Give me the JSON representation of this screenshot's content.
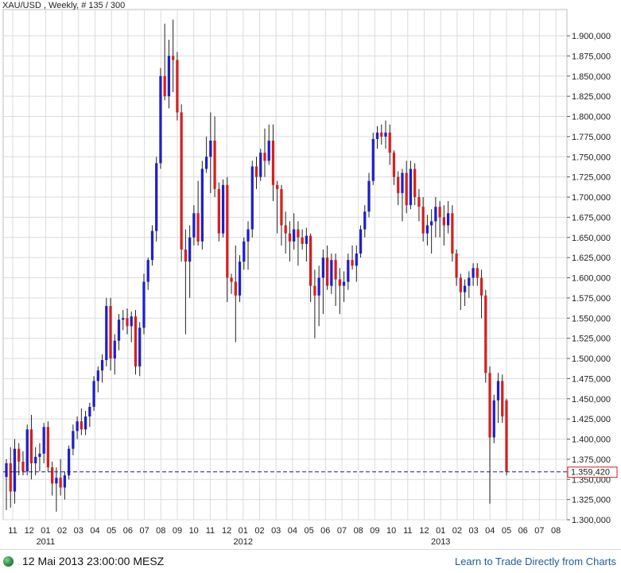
{
  "title": "XAU/USD , Weekly, # 135 / 300",
  "colors": {
    "up": "#1f1fc8",
    "down": "#d42020",
    "wick": "#222222",
    "grid": "#dcdcdc",
    "price_line": "#1a1a8c",
    "price_box": "#cc2222"
  },
  "footer": {
    "timestamp": "12 Mai 2013 23:00:00 MESZ",
    "link": "Learn to Trade Directly from Charts",
    "status_icon": "green-dot-icon"
  },
  "chart_data": {
    "type": "candlestick",
    "title": "XAU/USD , Weekly, # 135 / 300",
    "ylim": [
      1300,
      1925
    ],
    "yticks": [
      "1.300,000",
      "1.325,000",
      "1.350,000",
      "1.375,000",
      "1.400,000",
      "1.425,000",
      "1.450,000",
      "1.475,000",
      "1.500,000",
      "1.525,000",
      "1.550,000",
      "1.575,000",
      "1.600,000",
      "1.625,000",
      "1.650,000",
      "1.675,000",
      "1.700,000",
      "1.725,000",
      "1.750,000",
      "1.775,000",
      "1.800,000",
      "1.825,000",
      "1.850,000",
      "1.875,000",
      "1.900,000"
    ],
    "ytick_values": [
      1300,
      1325,
      1350,
      1375,
      1400,
      1425,
      1450,
      1475,
      1500,
      1525,
      1550,
      1575,
      1600,
      1625,
      1650,
      1675,
      1700,
      1725,
      1750,
      1775,
      1800,
      1825,
      1850,
      1875,
      1900
    ],
    "month_labels": [
      "11",
      "12",
      "01",
      "02",
      "03",
      "04",
      "05",
      "06",
      "07",
      "08",
      "09",
      "10",
      "11",
      "12",
      "01",
      "02",
      "03",
      "04",
      "05",
      "06",
      "07",
      "08",
      "09",
      "10",
      "11",
      "12",
      "01",
      "02",
      "03",
      "04",
      "05",
      "06",
      "07",
      "08"
    ],
    "year_labels": [
      {
        "label": "2011",
        "month_index": 2
      },
      {
        "label": "2012",
        "month_index": 14
      },
      {
        "label": "2013",
        "month_index": 26
      }
    ],
    "current_price": 1359.42,
    "current_price_label": "1.359,420",
    "candles": [
      [
        1353,
        1375,
        1312,
        1370
      ],
      [
        1370,
        1390,
        1315,
        1335
      ],
      [
        1335,
        1400,
        1320,
        1388
      ],
      [
        1388,
        1395,
        1355,
        1372
      ],
      [
        1372,
        1385,
        1355,
        1360
      ],
      [
        1360,
        1418,
        1355,
        1412
      ],
      [
        1412,
        1430,
        1350,
        1370
      ],
      [
        1370,
        1390,
        1355,
        1378
      ],
      [
        1378,
        1395,
        1360,
        1382
      ],
      [
        1382,
        1420,
        1370,
        1415
      ],
      [
        1415,
        1422,
        1360,
        1365
      ],
      [
        1365,
        1372,
        1330,
        1345
      ],
      [
        1345,
        1365,
        1310,
        1352
      ],
      [
        1352,
        1375,
        1330,
        1340
      ],
      [
        1340,
        1360,
        1325,
        1355
      ],
      [
        1355,
        1392,
        1350,
        1388
      ],
      [
        1388,
        1418,
        1380,
        1410
      ],
      [
        1410,
        1428,
        1400,
        1422
      ],
      [
        1422,
        1438,
        1405,
        1412
      ],
      [
        1412,
        1435,
        1405,
        1428
      ],
      [
        1428,
        1445,
        1415,
        1440
      ],
      [
        1440,
        1478,
        1435,
        1472
      ],
      [
        1472,
        1490,
        1458,
        1485
      ],
      [
        1485,
        1505,
        1470,
        1498
      ],
      [
        1498,
        1575,
        1490,
        1565
      ],
      [
        1565,
        1575,
        1485,
        1500
      ],
      [
        1500,
        1530,
        1480,
        1522
      ],
      [
        1522,
        1555,
        1510,
        1548
      ],
      [
        1548,
        1560,
        1535,
        1550
      ],
      [
        1550,
        1562,
        1530,
        1540
      ],
      [
        1540,
        1558,
        1520,
        1552
      ],
      [
        1552,
        1560,
        1480,
        1490
      ],
      [
        1490,
        1545,
        1478,
        1538
      ],
      [
        1538,
        1605,
        1530,
        1595
      ],
      [
        1595,
        1625,
        1585,
        1622
      ],
      [
        1622,
        1665,
        1615,
        1658
      ],
      [
        1658,
        1750,
        1645,
        1742
      ],
      [
        1742,
        1860,
        1735,
        1850
      ],
      [
        1850,
        1915,
        1820,
        1825
      ],
      [
        1825,
        1895,
        1810,
        1875
      ],
      [
        1875,
        1920,
        1830,
        1870
      ],
      [
        1870,
        1880,
        1795,
        1805
      ],
      [
        1805,
        1815,
        1620,
        1635
      ],
      [
        1635,
        1660,
        1530,
        1620
      ],
      [
        1620,
        1665,
        1575,
        1650
      ],
      [
        1650,
        1690,
        1640,
        1680
      ],
      [
        1680,
        1720,
        1640,
        1645
      ],
      [
        1645,
        1745,
        1635,
        1735
      ],
      [
        1735,
        1775,
        1730,
        1750
      ],
      [
        1750,
        1805,
        1705,
        1770
      ],
      [
        1770,
        1800,
        1700,
        1710
      ],
      [
        1710,
        1718,
        1645,
        1655
      ],
      [
        1655,
        1722,
        1650,
        1715
      ],
      [
        1715,
        1725,
        1570,
        1600
      ],
      [
        1600,
        1605,
        1580,
        1595
      ],
      [
        1595,
        1640,
        1520,
        1578
      ],
      [
        1578,
        1628,
        1570,
        1620
      ],
      [
        1620,
        1650,
        1610,
        1645
      ],
      [
        1645,
        1670,
        1610,
        1660
      ],
      [
        1660,
        1745,
        1650,
        1738
      ],
      [
        1738,
        1750,
        1710,
        1725
      ],
      [
        1725,
        1760,
        1720,
        1755
      ],
      [
        1755,
        1785,
        1725,
        1745
      ],
      [
        1745,
        1790,
        1740,
        1770
      ],
      [
        1770,
        1790,
        1695,
        1715
      ],
      [
        1715,
        1720,
        1655,
        1710
      ],
      [
        1710,
        1715,
        1640,
        1665
      ],
      [
        1665,
        1682,
        1630,
        1655
      ],
      [
        1655,
        1670,
        1620,
        1645
      ],
      [
        1645,
        1680,
        1635,
        1660
      ],
      [
        1660,
        1670,
        1615,
        1650
      ],
      [
        1650,
        1660,
        1635,
        1642
      ],
      [
        1642,
        1662,
        1620,
        1652
      ],
      [
        1652,
        1655,
        1570,
        1590
      ],
      [
        1590,
        1610,
        1525,
        1578
      ],
      [
        1578,
        1615,
        1540,
        1600
      ],
      [
        1600,
        1635,
        1555,
        1625
      ],
      [
        1625,
        1640,
        1585,
        1590
      ],
      [
        1590,
        1630,
        1580,
        1622
      ],
      [
        1622,
        1630,
        1565,
        1598
      ],
      [
        1598,
        1612,
        1555,
        1590
      ],
      [
        1590,
        1608,
        1570,
        1595
      ],
      [
        1595,
        1630,
        1585,
        1622
      ],
      [
        1622,
        1640,
        1610,
        1615
      ],
      [
        1615,
        1640,
        1595,
        1630
      ],
      [
        1630,
        1665,
        1625,
        1660
      ],
      [
        1660,
        1690,
        1650,
        1682
      ],
      [
        1682,
        1730,
        1675,
        1720
      ],
      [
        1720,
        1780,
        1715,
        1772
      ],
      [
        1772,
        1788,
        1760,
        1780
      ],
      [
        1780,
        1790,
        1765,
        1775
      ],
      [
        1775,
        1795,
        1760,
        1780
      ],
      [
        1780,
        1790,
        1740,
        1755
      ],
      [
        1755,
        1758,
        1715,
        1725
      ],
      [
        1725,
        1732,
        1690,
        1705
      ],
      [
        1705,
        1735,
        1670,
        1730
      ],
      [
        1730,
        1745,
        1680,
        1690
      ],
      [
        1690,
        1745,
        1685,
        1735
      ],
      [
        1735,
        1742,
        1690,
        1700
      ],
      [
        1700,
        1710,
        1670,
        1688
      ],
      [
        1688,
        1700,
        1645,
        1655
      ],
      [
        1655,
        1678,
        1640,
        1665
      ],
      [
        1665,
        1685,
        1630,
        1670
      ],
      [
        1670,
        1700,
        1650,
        1688
      ],
      [
        1688,
        1695,
        1650,
        1675
      ],
      [
        1675,
        1690,
        1640,
        1665
      ],
      [
        1665,
        1695,
        1655,
        1680
      ],
      [
        1680,
        1690,
        1620,
        1630
      ],
      [
        1630,
        1635,
        1590,
        1600
      ],
      [
        1600,
        1605,
        1560,
        1582
      ],
      [
        1582,
        1598,
        1565,
        1590
      ],
      [
        1590,
        1608,
        1575,
        1600
      ],
      [
        1600,
        1618,
        1590,
        1612
      ],
      [
        1612,
        1618,
        1590,
        1600
      ],
      [
        1600,
        1610,
        1550,
        1578
      ],
      [
        1578,
        1585,
        1470,
        1482
      ],
      [
        1482,
        1490,
        1320,
        1402
      ],
      [
        1402,
        1455,
        1395,
        1448
      ],
      [
        1448,
        1482,
        1420,
        1472
      ],
      [
        1472,
        1480,
        1420,
        1428
      ],
      [
        1448,
        1450,
        1355,
        1359.42
      ]
    ]
  }
}
